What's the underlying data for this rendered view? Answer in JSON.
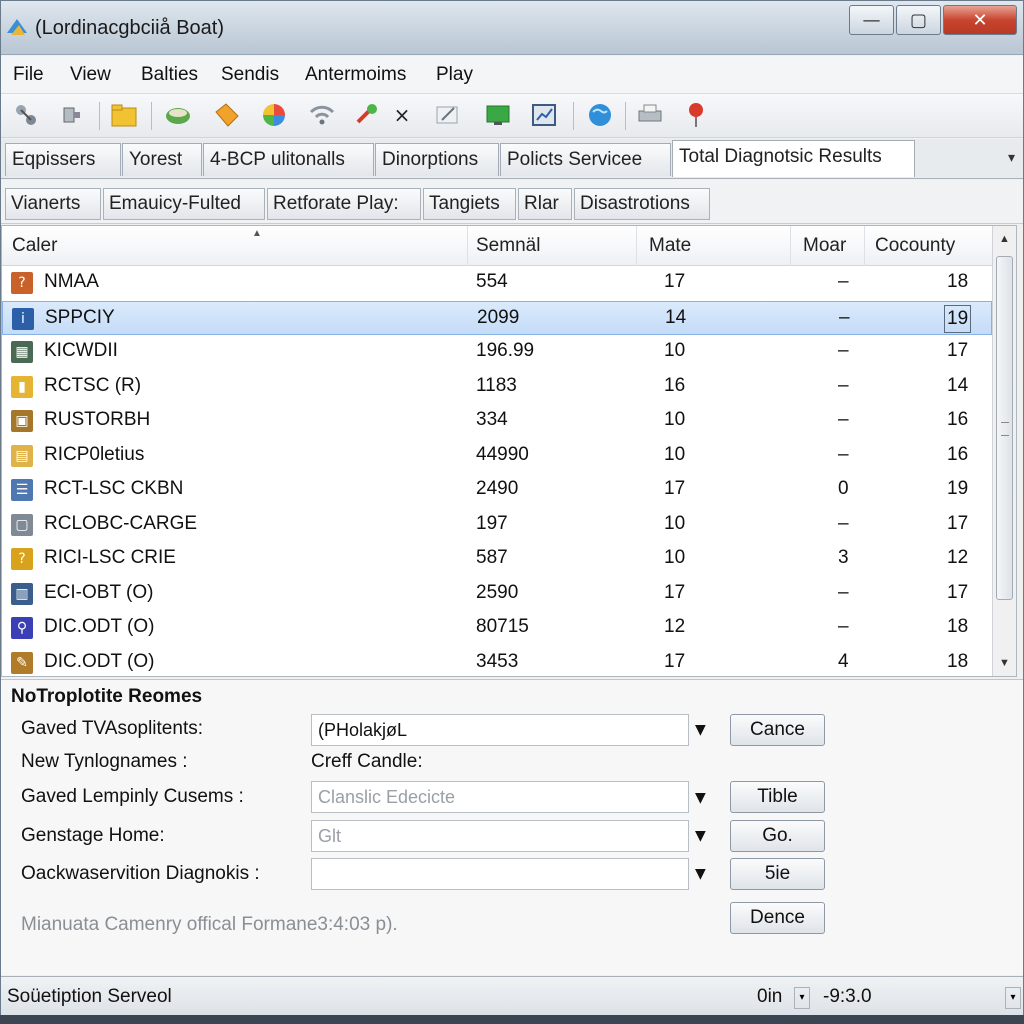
{
  "window": {
    "title": "(Lordinacgbciiå Boat)",
    "minimize_glyph": "—",
    "maximize_glyph": "▢",
    "close_glyph": "✕"
  },
  "menu": [
    "File",
    "View",
    "Balties",
    "Sendis",
    "Antermoims",
    "Play"
  ],
  "toolbar_icons": [
    "network-icon",
    "plug-icon",
    "folder-icon",
    "bowl-icon",
    "tag-icon",
    "color-wheel-icon",
    "wifi-icon",
    "tool-icon",
    "delete-icon",
    "edit-icon",
    "screen-icon",
    "chart-icon",
    "globe-icon",
    "printer-icon",
    "pin-icon"
  ],
  "toolbar_delete_glyph": "×",
  "tabs": [
    "Eqpissers",
    "Yorest",
    "4-BCP ulitonalls",
    "Dinorptions",
    "Policts Servicee",
    "Total Diagnotsic Results"
  ],
  "tab_overflow": "▾",
  "subtabs": [
    "Vianerts",
    "Emauicy-Fulted",
    "Retforate Play:",
    "Tangiets",
    "Rlar",
    "Disastrotions"
  ],
  "list": {
    "columns": {
      "name": "Caler",
      "semnal": "Semnäl",
      "mate": "Mate",
      "moar": "Moar",
      "cocounty": "Cocounty"
    },
    "sort_indicator": "▲",
    "rows": [
      {
        "name": "NMAA",
        "semnal": "554",
        "mate": "17",
        "moar": "–",
        "cocounty": "18",
        "icon": "warning-icon",
        "icon_glyph": "?",
        "icon_color": "#c8612a"
      },
      {
        "name": "SPPCIY",
        "semnal": "2099",
        "mate": "14",
        "moar": "–",
        "cocounty": "19",
        "icon": "info-icon",
        "icon_glyph": "i",
        "icon_color": "#2b5fa8",
        "selected": true
      },
      {
        "name": "KICWDII",
        "semnal": "196.99",
        "mate": "10",
        "moar": "–",
        "cocounty": "17",
        "icon": "grid-icon",
        "icon_glyph": "▦",
        "icon_color": "#4a6a54"
      },
      {
        "name": "RCTSC (R)",
        "semnal": "1183",
        "mate": "16",
        "moar": "–",
        "cocounty": "14",
        "icon": "folder-icon",
        "icon_glyph": "▮",
        "icon_color": "#e5b432"
      },
      {
        "name": "RUSTORBH",
        "semnal": "334",
        "mate": "10",
        "moar": "–",
        "cocounty": "16",
        "icon": "box-icon",
        "icon_glyph": "▣",
        "icon_color": "#a5772c"
      },
      {
        "name": "RICP0letius",
        "semnal": "44990",
        "mate": "10",
        "moar": "–",
        "cocounty": "16",
        "icon": "note-icon",
        "icon_glyph": "▤",
        "icon_color": "#e0b24a"
      },
      {
        "name": "RCT-LSC CKBN",
        "semnal": "2490",
        "mate": "17",
        "moar": "0",
        "cocounty": "19",
        "icon": "document-icon",
        "icon_glyph": "☰",
        "icon_color": "#4f78b0"
      },
      {
        "name": "RCLOBC-CARGE",
        "semnal": "197",
        "mate": "10",
        "moar": "–",
        "cocounty": "17",
        "icon": "page-icon",
        "icon_glyph": "▢",
        "icon_color": "#7f8a96"
      },
      {
        "name": "RICI-LSC CRIE",
        "semnal": "587",
        "mate": "10",
        "moar": "3",
        "cocounty": "12",
        "icon": "question-icon",
        "icon_glyph": "?",
        "icon_color": "#d9a21c"
      },
      {
        "name": "ECI-OBT (O)",
        "semnal": "2590",
        "mate": "17",
        "moar": "–",
        "cocounty": "17",
        "icon": "monitor-icon",
        "icon_glyph": "▥",
        "icon_color": "#3a5f8c"
      },
      {
        "name": "DIC.ODT (O)",
        "semnal": "80715",
        "mate": "12",
        "moar": "–",
        "cocounty": "18",
        "icon": "satellite-icon",
        "icon_glyph": "⚲",
        "icon_color": "#3b3fb5"
      },
      {
        "name": "DIC.ODT (O)",
        "semnal": "3453",
        "mate": "17",
        "moar": "4",
        "cocounty": "18",
        "icon": "tools-icon",
        "icon_glyph": "✎",
        "icon_color": "#b07c2a"
      }
    ]
  },
  "scrollbar": {
    "up": "▲",
    "down": "▼"
  },
  "details": {
    "title": "NoTroplotite Reomes",
    "fields": [
      {
        "label": "Gaved TVAsoplitents:",
        "value": "(PHolakjøL",
        "placeholder": "",
        "button": "Cance"
      },
      {
        "label": "New Tynlognames :",
        "text": "Creff Candle:"
      },
      {
        "label": "Gaved Lempinly Cusems :",
        "value": "",
        "placeholder": "Clanslic Edecicte",
        "button": "Tible"
      },
      {
        "label": "Genstage Home:",
        "value": "",
        "placeholder": "Glt",
        "button": "Go."
      },
      {
        "label": "Oackwaservition Diagnokis :",
        "value": "",
        "placeholder": "",
        "button": "5ie"
      }
    ],
    "dropdown_glyph": "▼",
    "note": "Mianuata Camenry offical Formane3:4:03 p).",
    "done_button": "Dence"
  },
  "status": {
    "left": "Soüetiption Serveol",
    "zoom": "0in",
    "zoom_arrow": "▾",
    "version": "-9:3.0",
    "grip": "▾"
  }
}
